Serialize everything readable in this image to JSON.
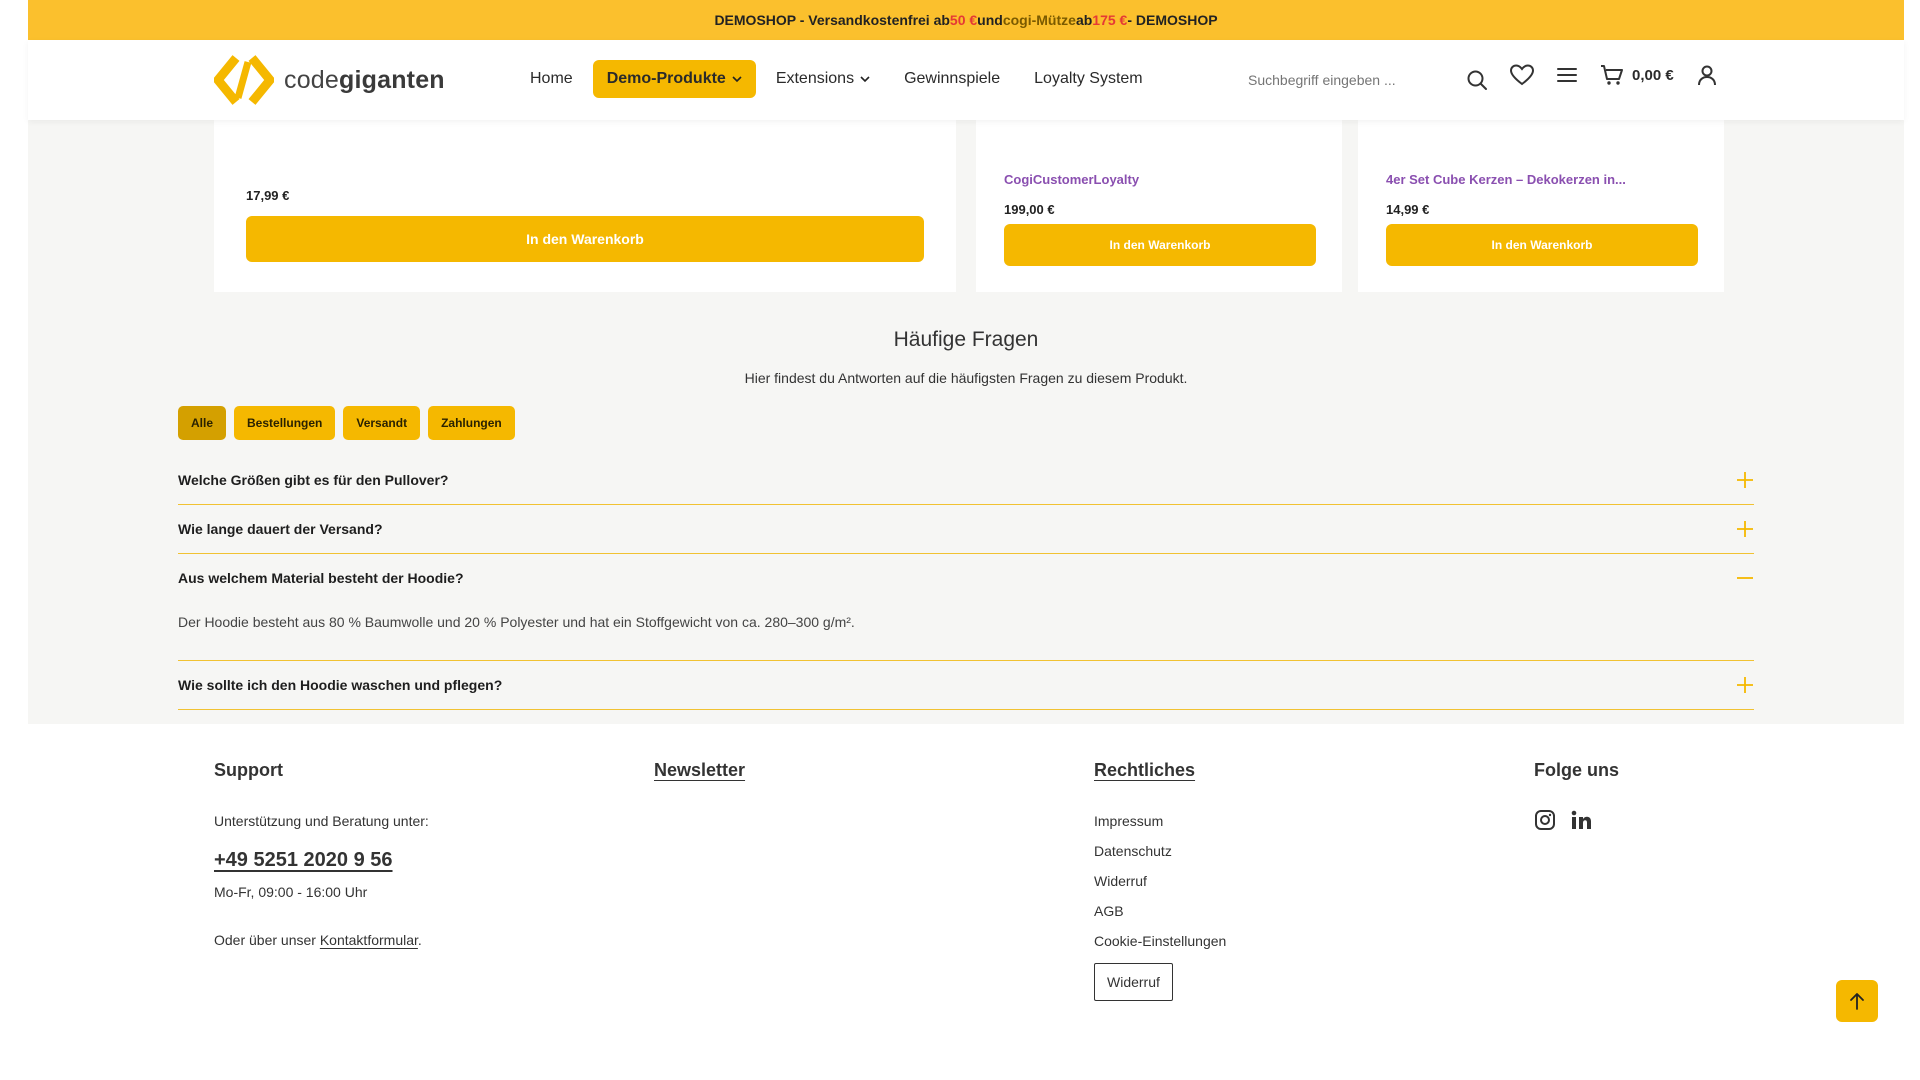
{
  "topbar": {
    "part1": "DEMOSHOP - Versandkostenfrei ab ",
    "amount1": "50 €",
    "part2": " und ",
    "product": "cogi-Mütze",
    "part3": " ab ",
    "amount2": "175 €",
    "part4": " - DEMOSHOP"
  },
  "header": {
    "logo_prefix": "code",
    "logo_bold": "giganten",
    "nav": [
      {
        "label": "Home"
      },
      {
        "label": "Demo-Produkte"
      },
      {
        "label": "Extensions"
      },
      {
        "label": "Gewinnspiele"
      },
      {
        "label": "Loyalty System"
      }
    ],
    "search_placeholder": "Suchbegriff eingeben ...",
    "cart_total": "0,00 €"
  },
  "products": [
    {
      "name": "",
      "price": "17,99 €",
      "button": "In den Warenkorb"
    },
    {
      "name": "CogiCustomerLoyalty",
      "price": "199,00 €",
      "button": "In den Warenkorb"
    },
    {
      "name": "4er Set Cube Kerzen – Dekokerzen in...",
      "price": "14,99 €",
      "button": "In den Warenkorb"
    }
  ],
  "faq": {
    "title": "Häufige Fragen",
    "subtitle": "Hier findest du Antworten auf die häufigsten Fragen zu diesem Produkt.",
    "filters": [
      "Alle",
      "Bestellungen",
      "Versandt",
      "Zahlungen"
    ],
    "items": [
      {
        "q": "Welche Größen gibt es für den Pullover?",
        "a": ""
      },
      {
        "q": "Wie lange dauert der Versand?",
        "a": ""
      },
      {
        "q": "Aus welchem Material besteht der Hoodie?",
        "a": "Der Hoodie besteht aus 80 % Baumwolle und 20 % Polyester und hat ein Stoffgewicht von ca. 280–300 g/m²."
      },
      {
        "q": "Wie sollte ich den Hoodie waschen und pflegen?",
        "a": ""
      }
    ]
  },
  "footer": {
    "support": {
      "title": "Support",
      "text": "Unterstützung und Beratung unter:",
      "phone": "+49 5251 2020 9 56",
      "hours": "Mo-Fr, 09:00 - 16:00 Uhr",
      "contact_prefix": "Oder über unser ",
      "contact_link": "Kontaktformular",
      "contact_suffix": "."
    },
    "newsletter": {
      "title": "Newsletter"
    },
    "legal": {
      "title": "Rechtliches",
      "links": [
        "Impressum",
        "Datenschutz",
        "Widerruf",
        "AGB",
        "Cookie-Einstellungen"
      ],
      "button": "Widerruf"
    },
    "social": {
      "title": "Folge uns"
    }
  },
  "colors": {
    "accent": "#f5b800",
    "topbar": "#fbc02d",
    "product_name": "#8a4fb0",
    "highlight_red": "#e53935"
  }
}
